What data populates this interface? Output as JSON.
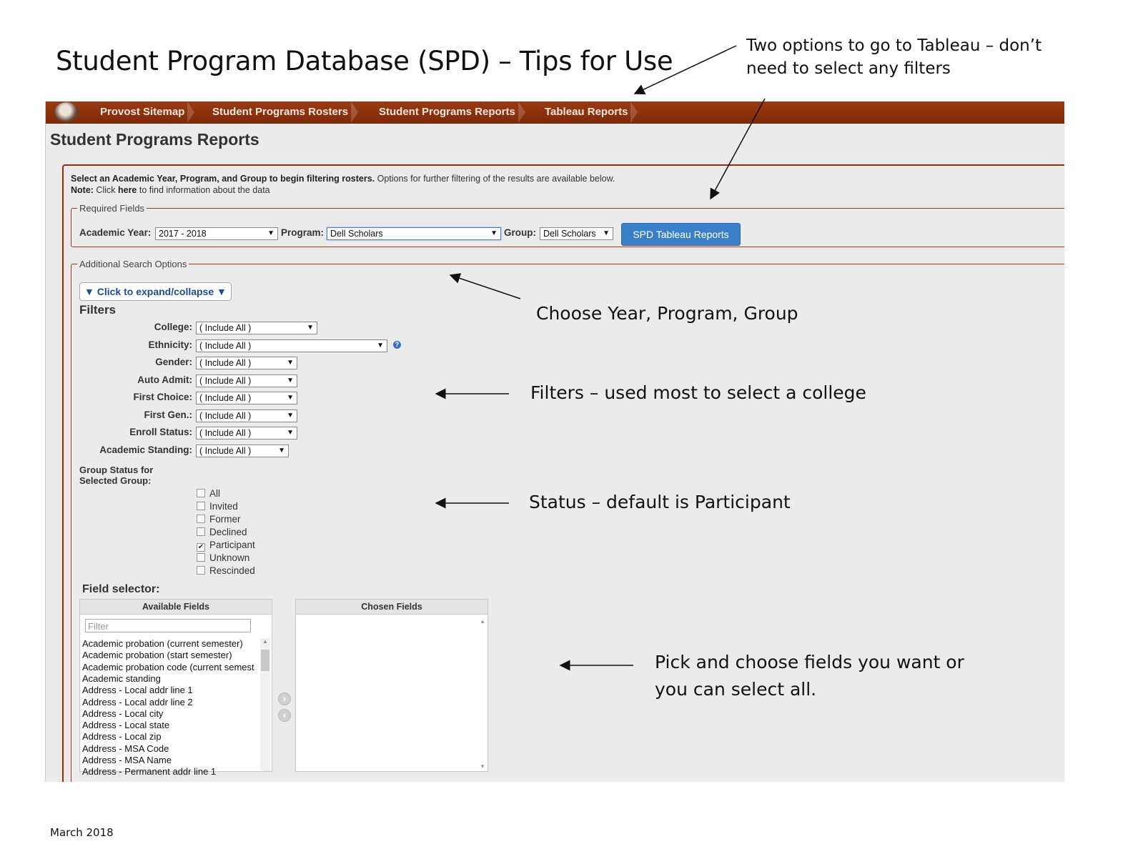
{
  "document": {
    "title": "Student Program Database (SPD) – Tips for Use",
    "footer": "March 2018",
    "annotations": {
      "tableau_line1": "Two options to go to Tableau – don’t",
      "tableau_line2": "need to select any filters",
      "choose": "Choose Year, Program, Group",
      "filters": "Filters – used most to select a college",
      "status": "Status – default is Participant",
      "fields_line1": "Pick and choose fields you want or",
      "fields_line2": "you can select all."
    }
  },
  "navbar": {
    "logo": "university-seal-icon",
    "items": [
      "Provost Sitemap",
      "Student Programs Rosters",
      "Student Programs Reports",
      "Tableau Reports"
    ]
  },
  "page": {
    "title": "Student Programs Reports",
    "intro_bold": "Select an Academic Year, Program, and Group to begin filtering rosters.",
    "intro_rest": " Options for further filtering of the results are available below.",
    "note_label": "Note:",
    "note_pre": " Click ",
    "note_link": "here",
    "note_post": " to find information about the data"
  },
  "required": {
    "legend": "Required Fields",
    "year_label": "Academic Year:",
    "year_value": "2017 - 2018",
    "program_label": "Program:",
    "program_value": "Dell Scholars",
    "group_label": "Group:",
    "group_value": "Dell Scholars",
    "tableau_button": "SPD Tableau Reports"
  },
  "additional": {
    "legend": "Additional Search Options",
    "expand": "▼ Click to expand/collapse ▼",
    "filters_title": "Filters",
    "filters": [
      {
        "label": "College:",
        "value": "( Include All )"
      },
      {
        "label": "Ethnicity:",
        "value": "( Include All )"
      },
      {
        "label": "Gender:",
        "value": "( Include All )"
      },
      {
        "label": "Auto Admit:",
        "value": "( Include All )"
      },
      {
        "label": "First Choice:",
        "value": "( Include All )"
      },
      {
        "label": "First Gen.:",
        "value": "( Include All )"
      },
      {
        "label": "Enroll Status:",
        "value": "( Include All )"
      },
      {
        "label": "Academic Standing:",
        "value": "( Include All )"
      }
    ],
    "group_status_line1": "Group Status for",
    "group_status_line2": "Selected Group:",
    "statuses": [
      {
        "label": "All",
        "checked": false
      },
      {
        "label": "Invited",
        "checked": false
      },
      {
        "label": "Former",
        "checked": false
      },
      {
        "label": "Declined",
        "checked": false
      },
      {
        "label": "Participant",
        "checked": true
      },
      {
        "label": "Unknown",
        "checked": false
      },
      {
        "label": "Rescinded",
        "checked": false
      }
    ]
  },
  "field_selector": {
    "title": "Field selector:",
    "available_header": "Available Fields",
    "chosen_header": "Chosen Fields",
    "filter_placeholder": "Filter",
    "available": [
      "Academic probation (current semester)",
      "Academic probation (start semester)",
      "Academic probation code (current semest",
      "Academic standing",
      "Address - Local addr line 1",
      "Address - Local addr line 2",
      "Address - Local city",
      "Address - Local state",
      "Address - Local zip",
      "Address - MSA Code",
      "Address - MSA Name",
      "Address - Permanent addr line 1"
    ]
  }
}
